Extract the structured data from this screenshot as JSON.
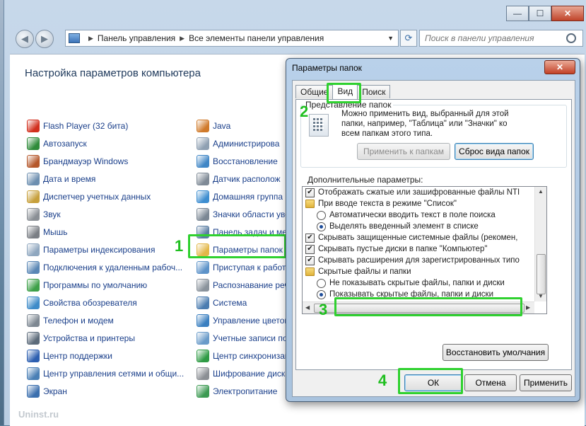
{
  "window": {
    "minimize_label": "—",
    "maximize_label": "☐",
    "close_label": "✕"
  },
  "navbar": {
    "back_label": "◀",
    "forward_label": "▶",
    "breadcrumb": [
      "Панель управления",
      "Все элементы панели управления"
    ],
    "search_placeholder": "Поиск в панели управления"
  },
  "page": {
    "title": "Настройка параметров компьютера"
  },
  "left_items": [
    {
      "label": "Flash Player (32 бита)",
      "icon": "flash-icon",
      "color": "#d22f1e"
    },
    {
      "label": "Автозапуск",
      "icon": "autoplay-icon",
      "color": "#2f8b3a"
    },
    {
      "label": "Брандмауэр Windows",
      "icon": "firewall-icon",
      "color": "#b5582c"
    },
    {
      "label": "Дата и время",
      "icon": "clock-icon",
      "color": "#6d8fb0"
    },
    {
      "label": "Диспетчер учетных данных",
      "icon": "credentials-icon",
      "color": "#c7a03c"
    },
    {
      "label": "Звук",
      "icon": "speaker-icon",
      "color": "#8a8f95"
    },
    {
      "label": "Мышь",
      "icon": "mouse-icon",
      "color": "#7b7f85"
    },
    {
      "label": "Параметры индексирования",
      "icon": "indexing-icon",
      "color": "#8fa7bf"
    },
    {
      "label": "Подключения к удаленным рабоч...",
      "icon": "remote-icon",
      "color": "#5a87b5"
    },
    {
      "label": "Программы по умолчанию",
      "icon": "default-programs-icon",
      "color": "#3ea049"
    },
    {
      "label": "Свойства обозревателя",
      "icon": "internet-options-icon",
      "color": "#3f8cc9"
    },
    {
      "label": "Телефон и модем",
      "icon": "phone-icon",
      "color": "#7e8892"
    },
    {
      "label": "Устройства и принтеры",
      "icon": "printer-icon",
      "color": "#5c6b7a"
    },
    {
      "label": "Центр поддержки",
      "icon": "flag-icon",
      "color": "#2d5fb0"
    },
    {
      "label": "Центр управления сетями и общи...",
      "icon": "network-icon",
      "color": "#4a7fb5"
    },
    {
      "label": "Экран",
      "icon": "display-icon",
      "color": "#3b6fae"
    }
  ],
  "right_items": [
    {
      "label": "Java",
      "icon": "java-icon",
      "color": "#d07a2a"
    },
    {
      "label": "Администрирова",
      "icon": "admin-tools-icon",
      "color": "#8fa0b2"
    },
    {
      "label": "Восстановление",
      "icon": "recovery-icon",
      "color": "#3f86c6"
    },
    {
      "label": "Датчик располож",
      "icon": "location-icon",
      "color": "#7f8a96"
    },
    {
      "label": "Домашняя группа",
      "icon": "homegroup-icon",
      "color": "#3e8ed0"
    },
    {
      "label": "Значки области уве",
      "icon": "tray-icon",
      "color": "#7b8794"
    },
    {
      "label": "Панель задач и мен",
      "icon": "taskbar-icon",
      "color": "#5b7ea3"
    },
    {
      "label": "Параметры папок",
      "icon": "folder-options-icon",
      "color": "#e2b748"
    },
    {
      "label": "Приступая к работе",
      "icon": "getting-started-icon",
      "color": "#5d93c9"
    },
    {
      "label": "Распознавание реч",
      "icon": "microphone-icon",
      "color": "#8a939c"
    },
    {
      "label": "Система",
      "icon": "system-icon",
      "color": "#4b7cb0"
    },
    {
      "label": "Управление цветом",
      "icon": "color-management-icon",
      "color": "#3a7fc0"
    },
    {
      "label": "Учетные записи по",
      "icon": "users-icon",
      "color": "#6a9bc9"
    },
    {
      "label": "Центр синхронизац",
      "icon": "sync-icon",
      "color": "#2f9b45"
    },
    {
      "label": "Шифрование диска",
      "icon": "bitlocker-icon",
      "color": "#8b8f94"
    },
    {
      "label": "Электропитание",
      "icon": "power-icon",
      "color": "#3c9a52"
    }
  ],
  "dialog": {
    "title": "Параметры папок",
    "close_label": "✕",
    "tabs": [
      "Общие",
      "Вид",
      "Поиск"
    ],
    "folder_views": {
      "legend": "Представление папок",
      "description": "Можно применить вид, выбранный для этой папки, например, \"Таблица\" или \"Значки\" ко всем папкам этого типа.",
      "apply_button": "Применить к папкам",
      "reset_button": "Сброс вида папок"
    },
    "advanced_label": "Дополнительные параметры:",
    "tree_items": [
      {
        "kind": "checkbox",
        "checked": true,
        "indent": 0,
        "label": "Отображать сжатые или зашифрованные файлы NTI"
      },
      {
        "kind": "folder",
        "indent": 0,
        "label": "При вводе текста в режиме \"Список\""
      },
      {
        "kind": "radio",
        "checked": false,
        "indent": 1,
        "label": "Автоматически вводить текст в поле поиска"
      },
      {
        "kind": "radio",
        "checked": true,
        "indent": 1,
        "label": "Выделять введенный элемент в списке"
      },
      {
        "kind": "checkbox",
        "checked": true,
        "indent": 0,
        "label": "Скрывать защищенные системные файлы (рекомен,"
      },
      {
        "kind": "checkbox",
        "checked": true,
        "indent": 0,
        "label": "Скрывать пустые диски в папке \"Компьютер\""
      },
      {
        "kind": "checkbox",
        "checked": true,
        "indent": 0,
        "label": "Скрывать расширения для зарегистрированных типо"
      },
      {
        "kind": "folder",
        "indent": 0,
        "label": "Скрытые файлы и папки"
      },
      {
        "kind": "radio",
        "checked": false,
        "indent": 1,
        "label": "Не показывать скрытые файлы, папки и диски"
      },
      {
        "kind": "radio",
        "checked": true,
        "indent": 1,
        "label": "Показывать скрытые файлы, папки и диски"
      }
    ],
    "restore_button": "Восстановить умолчания",
    "ok_button": "ОК",
    "cancel_button": "Отмена",
    "apply_button": "Применить"
  },
  "annotations": [
    "1",
    "2",
    "3",
    "4"
  ],
  "watermark": "Uninst.ru",
  "colors": {
    "highlight": "#2fd12f",
    "link": "#1a3f8a"
  }
}
